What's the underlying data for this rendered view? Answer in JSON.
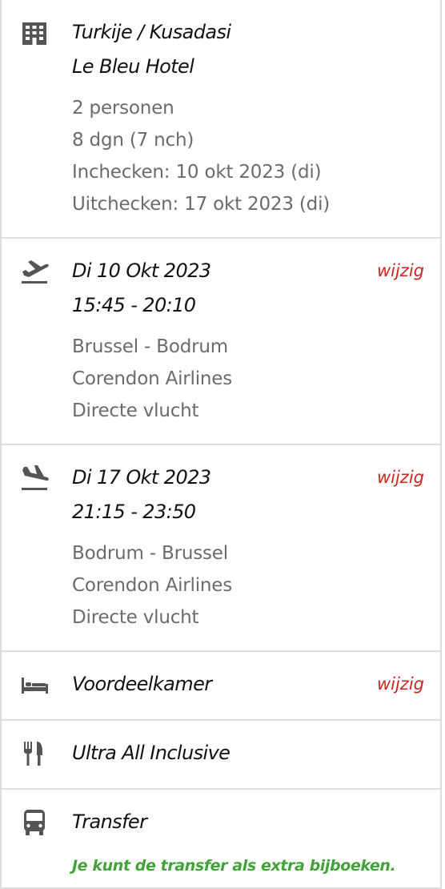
{
  "hotel": {
    "icon": "building-icon",
    "destination": "Turkije / Kusadasi",
    "name": "Le Bleu Hotel",
    "details": [
      "2 personen",
      "8 dgn (7 nch)",
      "Inchecken: 10 okt 2023 (di)",
      "Uitchecken: 17 okt 2023 (di)"
    ]
  },
  "outbound_flight": {
    "icon": "plane-departure-icon",
    "date": "Di 10 Okt 2023",
    "time": "15:45 - 20:10",
    "edit_label": "wijzig",
    "details": [
      "Brussel - Bodrum",
      "Corendon Airlines",
      "Directe vlucht"
    ]
  },
  "return_flight": {
    "icon": "plane-arrival-icon",
    "date": "Di 17 Okt 2023",
    "time": "21:15 - 23:50",
    "edit_label": "wijzig",
    "details": [
      "Bodrum - Brussel",
      "Corendon Airlines",
      "Directe vlucht"
    ]
  },
  "room": {
    "icon": "bed-icon",
    "label": "Voordeelkamer",
    "edit_label": "wijzig"
  },
  "board": {
    "icon": "fork-knife-icon",
    "label": "Ultra All Inclusive"
  },
  "transfer": {
    "icon": "bus-icon",
    "label": "Transfer",
    "note": "Je kunt de transfer als extra bijboeken."
  },
  "colors": {
    "edit_link": "#c8281d",
    "note_green": "#41a338",
    "secondary_text": "#6b6b6b",
    "divider": "#dcdcdc",
    "icon": "#555555"
  }
}
